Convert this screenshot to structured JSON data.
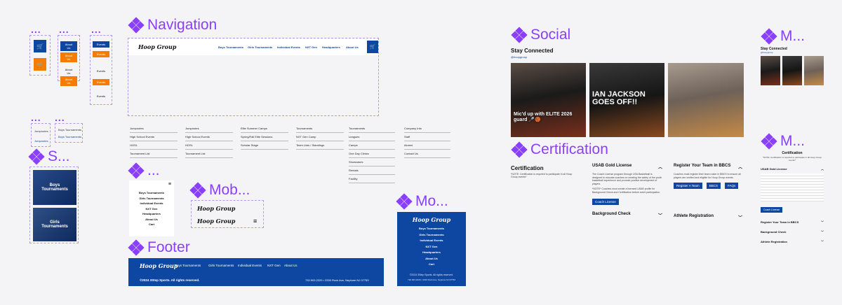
{
  "frames": {
    "navigation": "Navigation",
    "social": "Social",
    "certification": "Certification",
    "footer": "Footer",
    "mob": "Mob...",
    "mo": "Mo...",
    "m1": "M...",
    "m2": "M...",
    "s": "S...",
    "small": "...",
    "dots": "..."
  },
  "brand": "Hoop Group",
  "nav": [
    "Boys Tournaments",
    "Girls Tournaments",
    "Individual Events",
    "NXT Gen",
    "Headquarters",
    "About Us"
  ],
  "variants": {
    "about_us": "About Us",
    "events": "Events",
    "jumpnotes": "Jumpnotes",
    "boys_tournaments": "Boys Tournaments"
  },
  "menu_cols": [
    [
      "Jumpnotes",
      "High School Events",
      "HOSL",
      "Tournament List"
    ],
    [
      "Jumpnotes",
      "High School Events",
      "HOSL",
      "Tournament List"
    ],
    [
      "Elite Summer Camps",
      "Spring/Fall Elite Sessions",
      "Scholar Stage"
    ],
    [
      "Tournaments",
      "NXT Gen Camp",
      "Team Lists / Standings"
    ],
    [
      "Tournaments",
      "Leagues",
      "Camps",
      "One Day Clinics",
      "Showcases",
      "Rentals",
      "Facility"
    ],
    [
      "Company Info",
      "Staff",
      "Alumni",
      "Contact Us"
    ]
  ],
  "cards": [
    {
      "line1": "Boys",
      "line2": "Tournaments"
    },
    {
      "line1": "Girls",
      "line2": "Tournaments"
    }
  ],
  "mobile_menu": [
    "Boys Tournaments",
    "Girls Tournaments",
    "Individual Events",
    "NXT Gen",
    "Headquarters",
    "About Us",
    "Cart"
  ],
  "footer": {
    "links": [
      "Boys Tournaments",
      "Girls Tournaments",
      "Individual Events",
      "NXT Gen",
      "About Us"
    ],
    "copyright": "©2024 3Step Sports. All rights reserved.",
    "address": "732.903.2229 • 3330 Rock Ave, Neptune NJ 07753"
  },
  "mobile_footer": {
    "copyright": "©2024 3Step Sports. All rights reserved.",
    "address": "732.903.2229 • 3330 Rock Ave, Neptune NJ 07753"
  },
  "social": {
    "heading": "Stay Connected",
    "handle": "@hoopgroup",
    "photo1_caption": "Mic'd up with ELITE 2026 guard 🎤🏀",
    "photo2_caption": "IAN JACKSON GOES OFF!!",
    "mobile_heading": "Stay Connected"
  },
  "cert": {
    "heading": "Certification",
    "note": "*NOTE: Certification is required to participate in all Hoop Group events*",
    "usab_title": "USAB Gold License",
    "usab_text": "The Coach License program through USA Basketball is designed to educate coaches on creating the safety of the youth basketball experience and promote positive development of players.",
    "usab_text2": "*NOTE* Coaches must create a licensed USAB profile for Background Check and Certification before event participation.",
    "coach_license_btn": "Coach License",
    "background_check": "Background Check",
    "register_title": "Register Your Team in BBCS",
    "register_text": "Coaches must register their team roster in BBCS to ensure all players are verified and eligible for Hoop Group events.",
    "register_btn": "Register A Team",
    "bbcs_btn": "BBCS",
    "faqs_btn": "FAQs",
    "athlete_reg": "Athlete Registration",
    "mobile_heading": "Certification",
    "mobile_note": "*NOTE: Certification is required to participate in all Hoop Group events*",
    "mobile_usab": "USAB Gold License",
    "mobile_btn": "Coach License",
    "mobile_register": "Register Your Team in BBCS",
    "mobile_bg": "Background Check",
    "mobile_athlete": "Athlete Registration"
  },
  "colors": {
    "brand_blue": "#0d47a1",
    "accent_orange": "#f57c00",
    "frame_purple": "#8a3ffc"
  }
}
